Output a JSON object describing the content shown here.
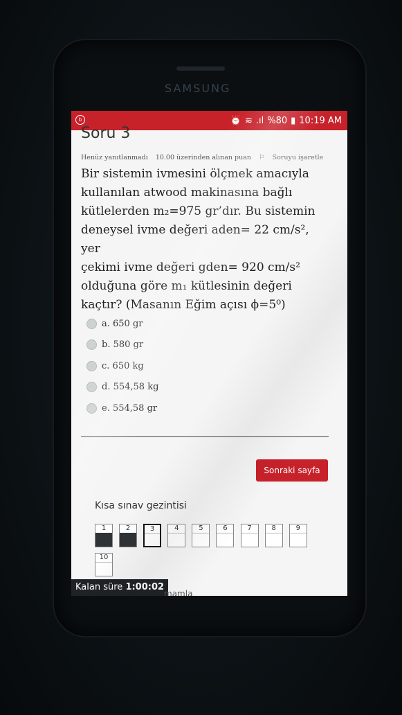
{
  "device": {
    "brand": "SAMSUNG"
  },
  "status_bar": {
    "battery": "%80",
    "time": "10:19 AM"
  },
  "question": {
    "title": "Soru 3",
    "state": "Henüz yanıtlanmadı",
    "points": "10.00 üzerinden alınan puan",
    "flag_label": "Soruyu işaretle",
    "text_lines": [
      "Bir sistemin ivmesini ölçmek amacıyla",
      "kullanılan atwood makinasına bağlı",
      "kütlelerden m₂=975 gr’dır. Bu sistemin",
      "deneysel ivme değeri aden= 22 cm/s², yer",
      "çekimi ivme değeri gden= 920 cm/s²",
      "olduğuna göre m₁ kütlesinin değeri",
      "kaçtır? (Masanın Eğim açısı ϕ=5⁰)"
    ],
    "options": [
      {
        "label": "a. 650 gr"
      },
      {
        "label": "b. 580 gr"
      },
      {
        "label": "c. 650 kg"
      },
      {
        "label": "d. 554,58 kg"
      },
      {
        "label": "e. 554,58 gr"
      }
    ]
  },
  "next_button": "Sonraki sayfa",
  "quiz_nav": {
    "title": "Kısa sınav gezintisi",
    "items": [
      {
        "num": "1",
        "state": "answered"
      },
      {
        "num": "2",
        "state": "answered"
      },
      {
        "num": "3",
        "state": "current"
      },
      {
        "num": "4",
        "state": "empty"
      },
      {
        "num": "5",
        "state": "empty"
      },
      {
        "num": "6",
        "state": "empty"
      },
      {
        "num": "7",
        "state": "empty"
      },
      {
        "num": "8",
        "state": "empty"
      },
      {
        "num": "9",
        "state": "empty"
      },
      {
        "num": "10",
        "state": "empty"
      }
    ]
  },
  "timer": {
    "label": "Kalan süre",
    "value": "1:00:02"
  },
  "bottom_text": "mamla",
  "colors": {
    "accent": "#c7212a",
    "dark": "#1f2326"
  }
}
